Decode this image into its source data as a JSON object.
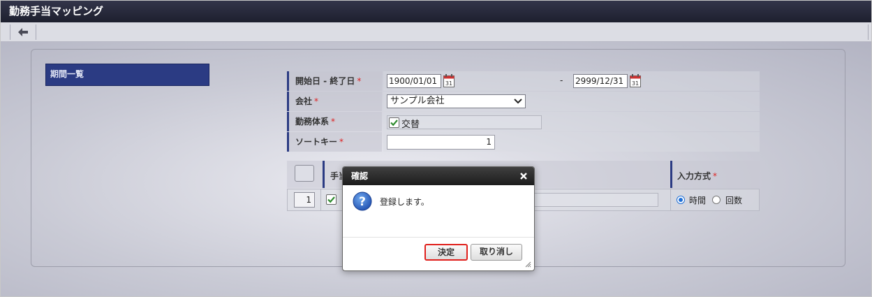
{
  "window": {
    "title": "勤務手当マッピング"
  },
  "toolbar": {
    "back_icon": "arrow-left-icon"
  },
  "left_panel": {
    "tab_label": "期間一覧"
  },
  "form": {
    "period": {
      "label": "開始日 - 終了日",
      "required": "*",
      "start": "1900/01/01",
      "separator": "-",
      "end": "2999/12/31",
      "calendar_text": "31"
    },
    "company": {
      "label": "会社",
      "required": "*",
      "selected": "サンプル会社"
    },
    "work_system": {
      "label": "勤務体系",
      "required": "*",
      "value": "交替",
      "checked": true
    },
    "sort_key": {
      "label": "ソートキー",
      "required": "*",
      "value": "1"
    }
  },
  "grid": {
    "columns": {
      "allowance": "手当",
      "input_method": "入力方式",
      "required": "*"
    },
    "rows": [
      {
        "no": "1",
        "checked": true,
        "input_method": {
          "options": [
            "時間",
            "回数"
          ],
          "selected": "時間"
        }
      }
    ]
  },
  "dialog": {
    "title": "確認",
    "message": "登録します。",
    "ok_label": "決定",
    "cancel_label": "取り消し",
    "icon": "info-question-icon"
  },
  "colors": {
    "title_bar": "#1d1f2e",
    "accent": "#2b3b83",
    "required": "#dd2222",
    "highlight": "#e0201c"
  }
}
